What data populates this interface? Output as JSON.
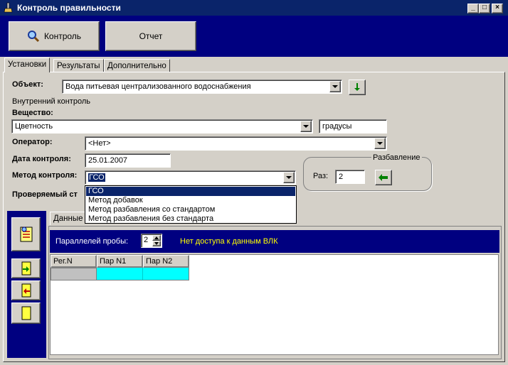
{
  "window": {
    "title": "Контроль правильности",
    "minimize": "_",
    "maximize": "□",
    "close": "×"
  },
  "toolbar": {
    "control_label": "Контроль",
    "report_label": "Отчет"
  },
  "tabs": [
    "Установки",
    "Результаты",
    "Дополнительно"
  ],
  "form": {
    "object_label": "Объект:",
    "object_value": "Вода  питьевая централизованного водоснабжения",
    "internal_control": "Внутренний контроль",
    "substance_label": "Вещество:",
    "substance_value": "Цветность",
    "unit_value": "градусы",
    "operator_label": "Оператор:",
    "operator_value": "<Нет>",
    "date_label": "Дата контроля:",
    "date_value": "25.01.2007",
    "method_label": "Метод контроля:",
    "method_value": "ГСО",
    "checked_label": "Проверяемый ст"
  },
  "method_options": [
    "ГСО",
    "Метод добавок",
    "Метод разбавления со стандартом",
    "Метод разбавления без стандарта"
  ],
  "dilution": {
    "title": "Разбавление",
    "times_label": "Раз:",
    "times_value": "2"
  },
  "lower": {
    "tab_label": "Данные к",
    "parallels_label": "Параллелей пробы:",
    "parallels_value": "2",
    "no_access": "Нет доступа к данным ВЛК",
    "columns": [
      "Рег.N",
      "Пар N1",
      "Пар N2"
    ]
  },
  "colors": {
    "title_bar": "#0a246a",
    "toolbar": "#000080",
    "grid_highlight": "#00ffff"
  }
}
